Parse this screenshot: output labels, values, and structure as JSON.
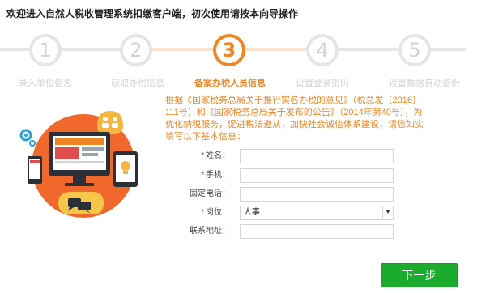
{
  "header": {
    "title": "欢迎进入自然人税收管理系统扣缴客户端，初次使用请按本向导操作"
  },
  "steps": [
    {
      "number": "1",
      "label": "录入单位信息",
      "active": false
    },
    {
      "number": "2",
      "label": "获取办税信息",
      "active": false
    },
    {
      "number": "3",
      "label": "备案办税人员信息",
      "active": true
    },
    {
      "number": "4",
      "label": "设置登录密码",
      "active": false
    },
    {
      "number": "5",
      "label": "设置数据自动备份",
      "active": false
    }
  ],
  "intro": "根据《国家税务总局关于推行实名办税的意见》（税总发〔2016〕111号）和《国家税务总局关于发布的公告》（2014年第40号），为优化纳税服务，促进税法遵从，加快社会诚信体系建设，请您如实填写以下基本信息：",
  "form": {
    "name": {
      "label": "姓名：",
      "required": true,
      "value": ""
    },
    "mobile": {
      "label": "手机：",
      "required": true,
      "value": ""
    },
    "phone": {
      "label": "固定电话：",
      "required": false,
      "value": ""
    },
    "position": {
      "label": "岗位：",
      "required": true,
      "value": "人事"
    },
    "address": {
      "label": "联系地址：",
      "required": false,
      "value": ""
    },
    "required_mark": "*"
  },
  "buttons": {
    "next": "下一步"
  },
  "colors": {
    "accent": "#f08523",
    "button": "#1bac2e",
    "inactive": "#d3d3d3",
    "required": "#e02020"
  },
  "icons": [
    "gear-icon",
    "team-icon",
    "lightbulb-icon",
    "chat-icon",
    "computer-icon",
    "tablet-icon",
    "phone-icon"
  ]
}
